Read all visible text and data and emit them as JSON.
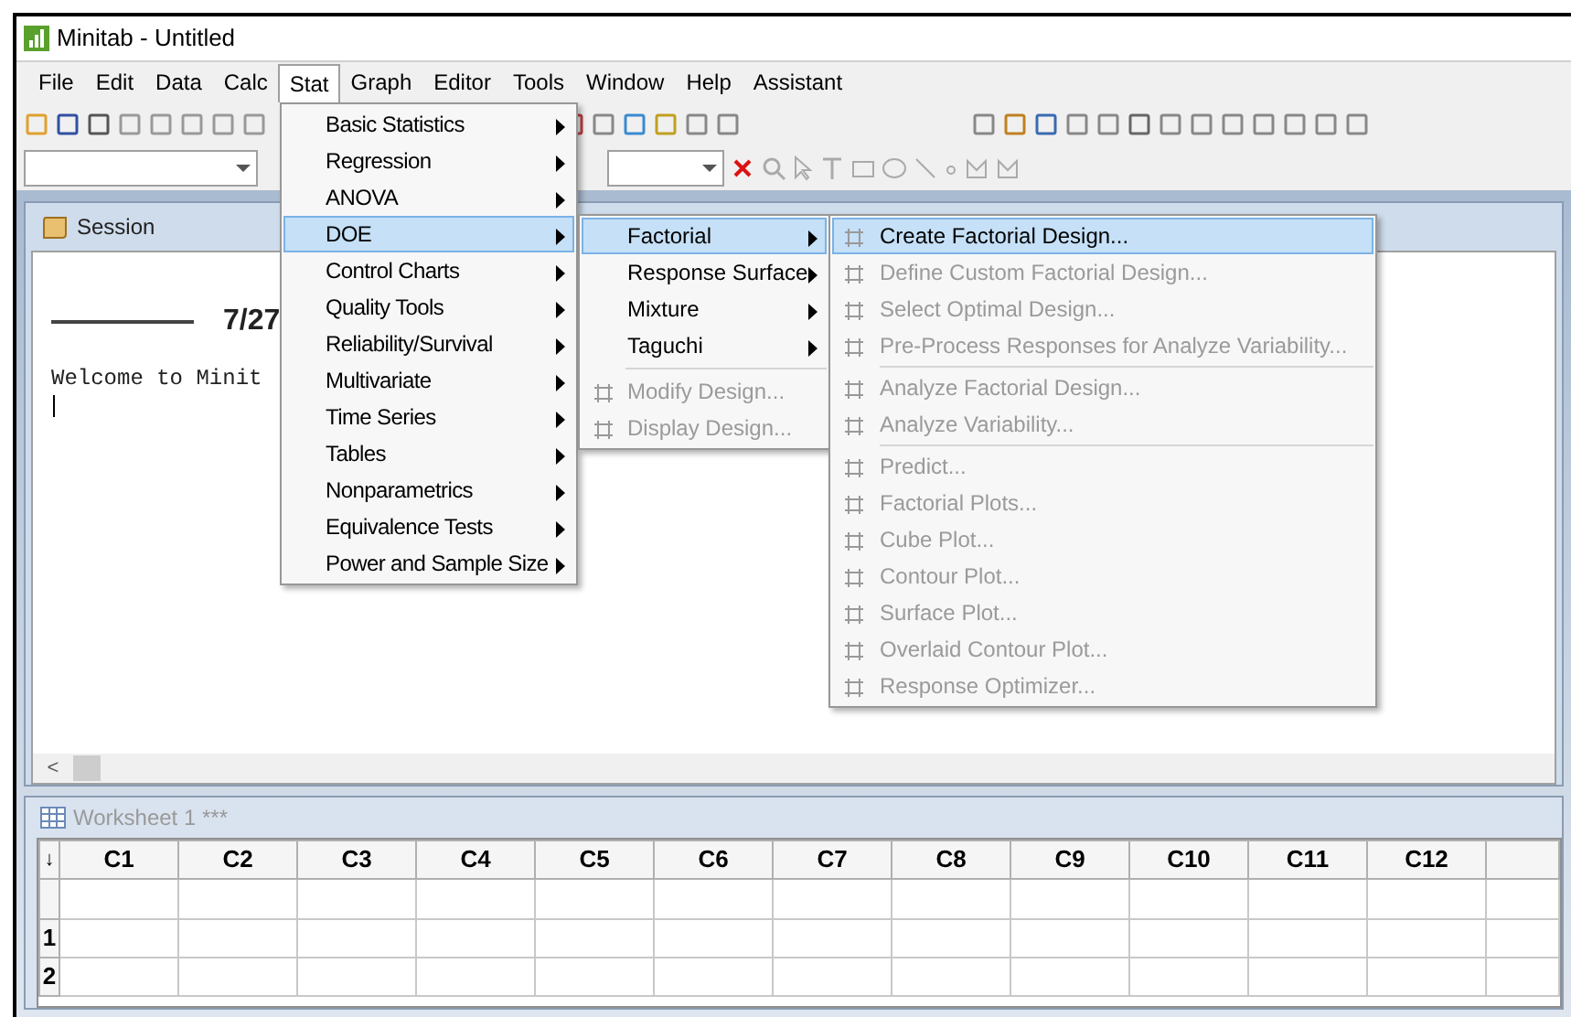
{
  "window": {
    "title": "Minitab - Untitled"
  },
  "menu_bar": [
    {
      "label": "File",
      "selected": false
    },
    {
      "label": "Edit",
      "selected": false
    },
    {
      "label": "Data",
      "selected": false
    },
    {
      "label": "Calc",
      "selected": false
    },
    {
      "label": "Stat",
      "selected": true
    },
    {
      "label": "Graph",
      "selected": false
    },
    {
      "label": "Editor",
      "selected": false
    },
    {
      "label": "Tools",
      "selected": false
    },
    {
      "label": "Window",
      "selected": false
    },
    {
      "label": "Help",
      "selected": false
    },
    {
      "label": "Assistant",
      "selected": false
    }
  ],
  "session": {
    "title": "Session",
    "date_text": "7/27",
    "welcome_text": "Welcome to Minit",
    "scroll_left": "<"
  },
  "stat_menu": [
    {
      "label": "Basic Statistics",
      "selected": false
    },
    {
      "label": "Regression",
      "selected": false
    },
    {
      "label": "ANOVA",
      "selected": false
    },
    {
      "label": "DOE",
      "selected": true
    },
    {
      "label": "Control Charts",
      "selected": false
    },
    {
      "label": "Quality Tools",
      "selected": false
    },
    {
      "label": "Reliability/Survival",
      "selected": false
    },
    {
      "label": "Multivariate",
      "selected": false
    },
    {
      "label": "Time Series",
      "selected": false
    },
    {
      "label": "Tables",
      "selected": false
    },
    {
      "label": "Nonparametrics",
      "selected": false
    },
    {
      "label": "Equivalence Tests",
      "selected": false
    },
    {
      "label": "Power and Sample Size",
      "selected": false
    }
  ],
  "doe_menu": [
    {
      "kind": "submenu",
      "label": "Factorial",
      "selected": true,
      "disabled": false
    },
    {
      "kind": "submenu",
      "label": "Response Surface",
      "selected": false,
      "disabled": false
    },
    {
      "kind": "submenu",
      "label": "Mixture",
      "selected": false,
      "disabled": false
    },
    {
      "kind": "submenu",
      "label": "Taguchi",
      "selected": false,
      "disabled": false
    },
    {
      "kind": "separator"
    },
    {
      "kind": "command",
      "label": "Modify Design...",
      "selected": false,
      "disabled": true
    },
    {
      "kind": "command",
      "label": "Display Design...",
      "selected": false,
      "disabled": true
    }
  ],
  "factorial_menu": [
    {
      "kind": "command",
      "label": "Create Factorial Design...",
      "selected": true,
      "disabled": false
    },
    {
      "kind": "command",
      "label": "Define Custom Factorial Design...",
      "selected": false,
      "disabled": true
    },
    {
      "kind": "command",
      "label": "Select Optimal Design...",
      "selected": false,
      "disabled": true
    },
    {
      "kind": "command",
      "label": "Pre-Process Responses for Analyze Variability...",
      "selected": false,
      "disabled": true
    },
    {
      "kind": "separator"
    },
    {
      "kind": "command",
      "label": "Analyze Factorial Design...",
      "selected": false,
      "disabled": true
    },
    {
      "kind": "command",
      "label": "Analyze Variability...",
      "selected": false,
      "disabled": true
    },
    {
      "kind": "separator"
    },
    {
      "kind": "command",
      "label": "Predict...",
      "selected": false,
      "disabled": true
    },
    {
      "kind": "command",
      "label": "Factorial Plots...",
      "selected": false,
      "disabled": true
    },
    {
      "kind": "command",
      "label": "Cube Plot...",
      "selected": false,
      "disabled": true
    },
    {
      "kind": "command",
      "label": "Contour Plot...",
      "selected": false,
      "disabled": true
    },
    {
      "kind": "command",
      "label": "Surface Plot...",
      "selected": false,
      "disabled": true
    },
    {
      "kind": "command",
      "label": "Overlaid Contour Plot...",
      "selected": false,
      "disabled": true
    },
    {
      "kind": "command",
      "label": "Response Optimizer...",
      "selected": false,
      "disabled": true
    }
  ],
  "worksheet": {
    "title": "Worksheet 1 ***",
    "corner": "↓",
    "columns": [
      "C1",
      "C2",
      "C3",
      "C4",
      "C5",
      "C6",
      "C7",
      "C8",
      "C9",
      "C10",
      "C11",
      "C12"
    ],
    "rows": [
      "1",
      "2"
    ]
  }
}
